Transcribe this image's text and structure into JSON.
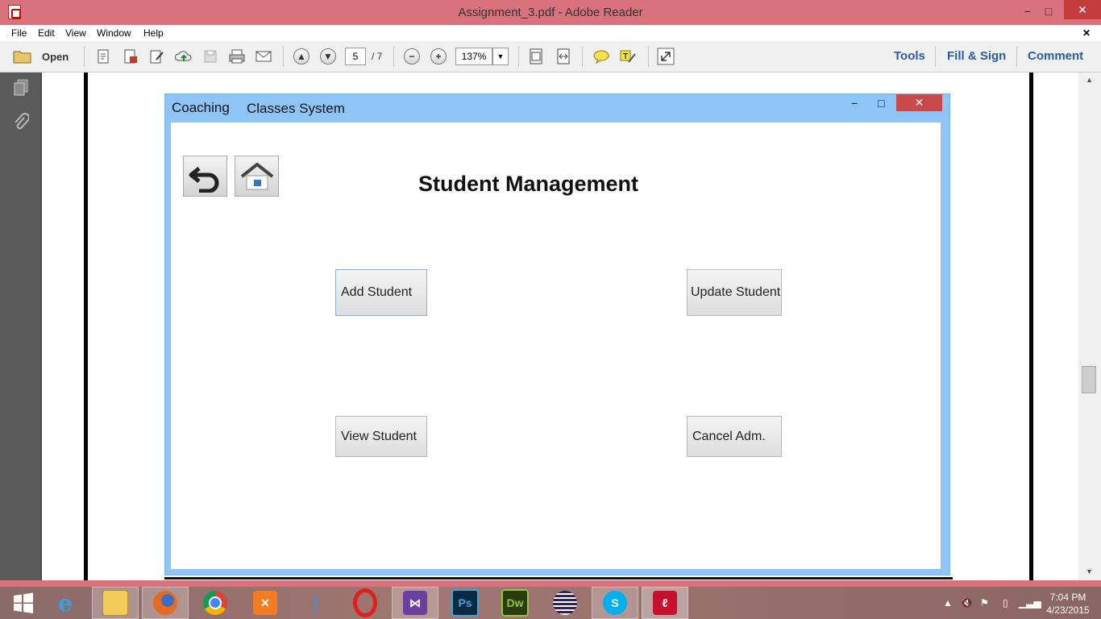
{
  "window": {
    "title": "Assignment_3.pdf - Adobe Reader",
    "minimize_glyph": "−",
    "maximize_glyph": "□",
    "close_glyph": "✕",
    "menu_close_glyph": "✕"
  },
  "menu": [
    "File",
    "Edit",
    "View",
    "Window",
    "Help"
  ],
  "toolbar": {
    "open_label": "Open",
    "page_current": "5",
    "page_total": "/ 7",
    "zoom": "137%",
    "tools_label": "Tools",
    "fill_sign_label": "Fill & Sign",
    "comment_label": "Comment"
  },
  "dialog": {
    "title_part1": "Coaching",
    "title_part2": "Classes System",
    "minimize_glyph": "−",
    "maximize_glyph": "□",
    "close_glyph": "✕",
    "heading": "Student Management",
    "buttons": {
      "add": "Add Student",
      "update": "Update Student",
      "view": "View Student",
      "cancel": "Cancel Adm."
    }
  },
  "taskbar": {
    "time": "7:04 PM",
    "date": "4/23/2015",
    "apps": [
      "ie-icon",
      "file-explorer-icon",
      "firefox-icon",
      "chrome-icon",
      "xampp-icon",
      "mysql-icon",
      "opera-icon",
      "visual-studio-icon",
      "photoshop-icon",
      "dreamweaver-icon",
      "eclipse-icon",
      "skype-icon",
      "adobe-reader-icon"
    ],
    "ps_label": "Ps",
    "dw_label": "Dw"
  },
  "colors": {
    "titlebar": "#d9727c",
    "dialog_frame": "#8ec5f6",
    "link": "#2a5d9f"
  }
}
